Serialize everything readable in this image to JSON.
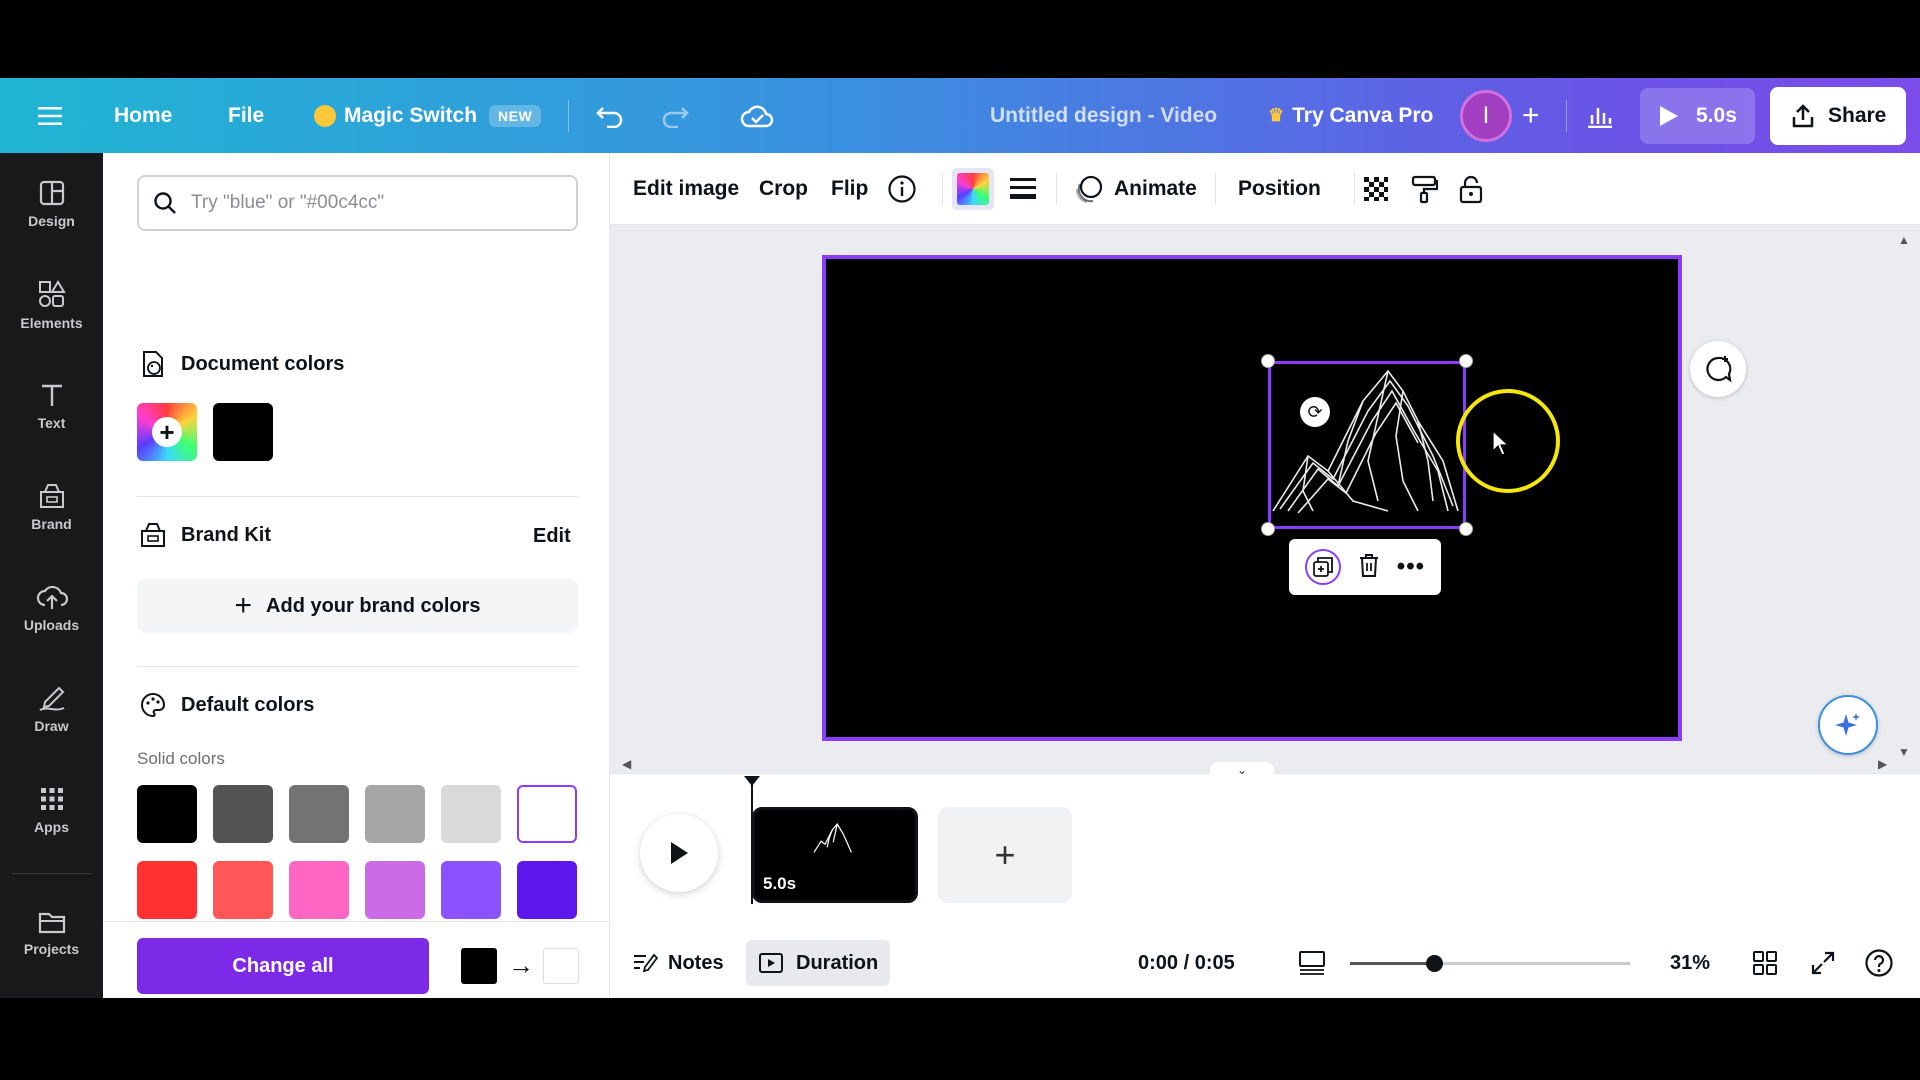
{
  "topbar": {
    "home": "Home",
    "file": "File",
    "magic_switch": "Magic Switch",
    "new_badge": "NEW",
    "doc_title": "Untitled design - Video",
    "try_pro": "Try Canva Pro",
    "avatar_initial": "I",
    "play_duration": "5.0s",
    "share": "Share"
  },
  "rail": {
    "items": [
      {
        "label": "Design",
        "icon": "design-icon"
      },
      {
        "label": "Elements",
        "icon": "elements-icon"
      },
      {
        "label": "Text",
        "icon": "text-icon"
      },
      {
        "label": "Brand",
        "icon": "brand-icon"
      },
      {
        "label": "Uploads",
        "icon": "uploads-icon"
      },
      {
        "label": "Draw",
        "icon": "draw-icon"
      },
      {
        "label": "Apps",
        "icon": "apps-icon"
      },
      {
        "label": "Projects",
        "icon": "projects-icon"
      }
    ]
  },
  "panel": {
    "search_placeholder": "Try \"blue\" or \"#00c4cc\"",
    "document_colors": "Document colors",
    "brand_kit": "Brand Kit",
    "edit": "Edit",
    "add_brand_colors": "Add your brand colors",
    "default_colors": "Default colors",
    "solid_colors": "Solid colors",
    "change_all": "Change all",
    "document_swatches": [
      "#000000"
    ],
    "solid_rows": [
      [
        "#000000",
        "#545454",
        "#737373",
        "#a6a6a6",
        "#d9d9d9",
        "#ffffff"
      ],
      [
        "#ff3131",
        "#ff5757",
        "#ff66c4",
        "#cb6ce6",
        "#8c52ff",
        "#5e17eb"
      ],
      [
        "#0097b2",
        "#0cc0df",
        "#5ce1e6",
        "#38b6ff",
        "#5271ff",
        "#004aad"
      ]
    ],
    "replace_from": "#000000",
    "replace_to": "#ffffff"
  },
  "context_toolbar": {
    "edit_image": "Edit image",
    "crop": "Crop",
    "flip": "Flip",
    "animate": "Animate",
    "position": "Position"
  },
  "timeline": {
    "clip_duration": "5.0s",
    "notes": "Notes",
    "duration": "Duration",
    "time": "0:00 / 0:05",
    "zoom": "31%",
    "zoom_level": 0.3
  },
  "colors": {
    "accent": "#8b3dff",
    "button_purple": "#7d2ae8",
    "rail_bg": "#18191b"
  }
}
